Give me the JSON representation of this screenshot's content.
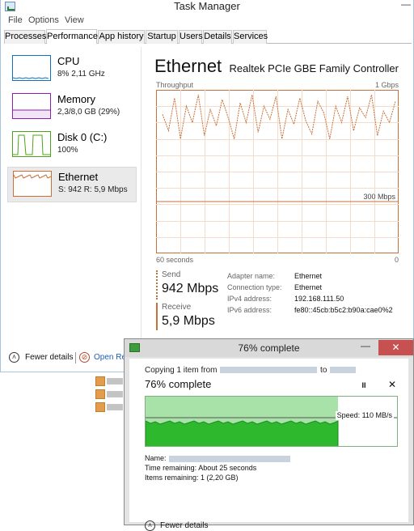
{
  "window": {
    "title": "Task Manager",
    "minimize_glyph": "—"
  },
  "menu": [
    "File",
    "Options",
    "View"
  ],
  "tabs": [
    "Processes",
    "Performance",
    "App history",
    "Startup",
    "Users",
    "Details",
    "Services"
  ],
  "active_tab": "Performance",
  "sidebar": [
    {
      "name": "CPU",
      "detail": "8% 2,11 GHz",
      "color": "#1170c0"
    },
    {
      "name": "Memory",
      "detail": "2,3/8,0 GB (29%)",
      "color": "#8b1fae"
    },
    {
      "name": "Disk 0 (C:)",
      "detail": "100%",
      "color": "#4da31c"
    },
    {
      "name": "Ethernet",
      "detail": "S: 942 R: 5,9 Mbps",
      "color": "#c8703a"
    }
  ],
  "ethernet": {
    "title": "Ethernet",
    "adapter": "Realtek PCIe GBE Family Controller",
    "graph_label": "Throughput",
    "graph_max": "1 Gbps",
    "graph_mid": "300 Mbps",
    "x_left": "60 seconds",
    "x_right": "0",
    "graph_series": [
      0.85,
      0.75,
      0.95,
      0.7,
      0.9,
      0.8,
      0.97,
      0.72,
      0.88,
      0.78,
      0.94,
      0.83,
      0.7,
      0.92,
      0.8,
      0.97,
      0.74,
      0.9,
      0.82,
      0.96,
      0.7,
      0.88,
      0.79,
      0.95,
      0.81,
      0.73,
      0.93,
      0.86,
      0.7,
      0.9,
      0.8,
      0.96,
      0.75,
      0.89,
      0.83,
      0.97,
      0.72,
      0.87,
      0.8,
      0.93
    ],
    "send_label": "Send",
    "send_value": "942 Mbps",
    "receive_label": "Receive",
    "receive_value": "5,9 Mbps",
    "info": [
      {
        "key": "Adapter name:",
        "value": "Ethernet"
      },
      {
        "key": "Connection type:",
        "value": "Ethernet"
      },
      {
        "key": "IPv4 address:",
        "value": "192.168.111.50"
      },
      {
        "key": "IPv6 address:",
        "value": "fe80::45cb:b5c2:b90a:cae0%2"
      }
    ]
  },
  "footer": {
    "fewer_details": "Fewer details",
    "open_resource_monitor": "Open Res"
  },
  "copy_dialog": {
    "title": "76% complete",
    "copy_prefix": "Copying 1 item from",
    "copy_to": "to",
    "heading": "76% complete",
    "progress": 0.76,
    "speed": "Speed: 110 MB/s",
    "name_label": "Name:",
    "time_remaining": "Time remaining:  About 25 seconds",
    "items_remaining": "Items remaining:  1 (2,20 GB)",
    "fewer_details": "Fewer details",
    "close_glyph": "✕",
    "minimize_glyph": "—",
    "pause_glyph": "II",
    "cancel_glyph": "✕"
  }
}
